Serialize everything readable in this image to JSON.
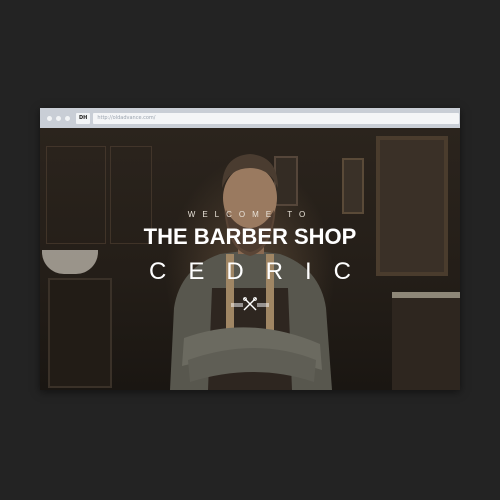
{
  "browser": {
    "favicon_label": "DH",
    "url": "http://oldadvance.com/"
  },
  "hero": {
    "welcome": "WELCOME TO",
    "title": "THE BARBER SHOP",
    "name": "CEDRIC",
    "emblem_icon": "scissors-razor-emblem-icon"
  },
  "colors": {
    "background": "#232323",
    "browser_chrome": "#c9ced6",
    "hero_text": "#ffffff"
  }
}
